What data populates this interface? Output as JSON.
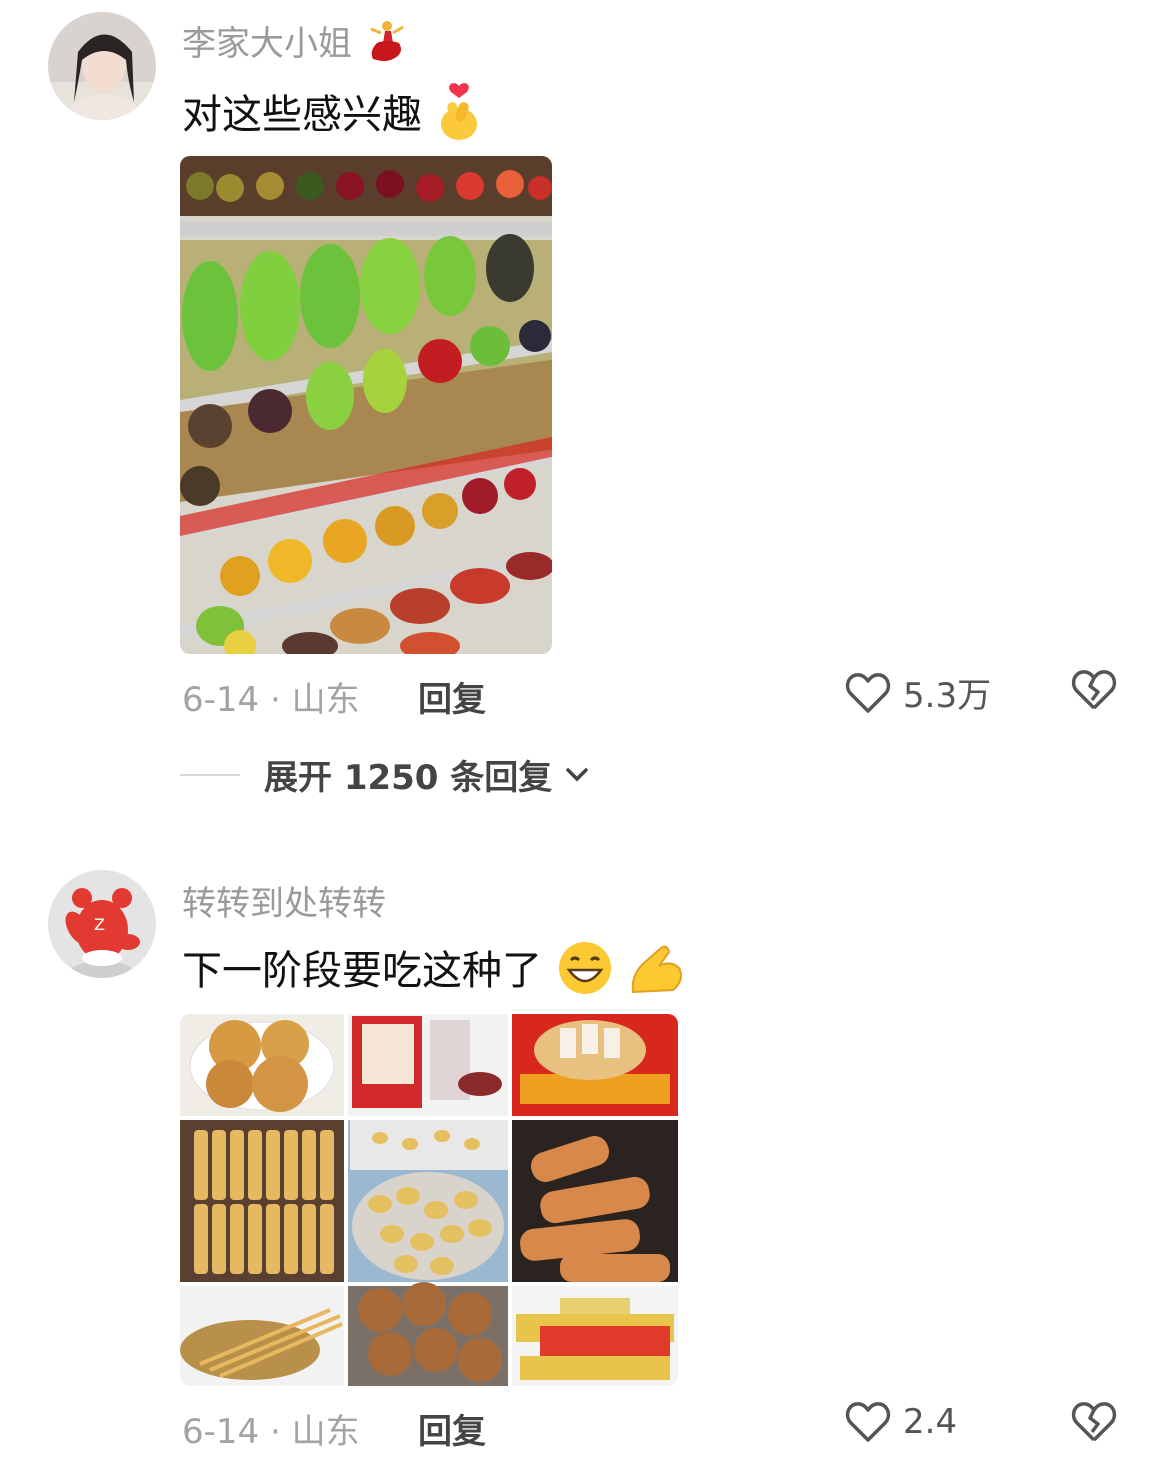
{
  "comments": [
    {
      "username": "李家大小姐",
      "username_badge_icon": "flamenco-dancer-emoji",
      "text": "对这些感兴趣",
      "text_emoji_icon": "finger-heart-emoji",
      "image_subject": "fruit-shelf-photo",
      "date_location": "6-14 · 山东",
      "reply_label": "回复",
      "like_count": "5.3万",
      "expand_label": "展开 1250 条回复"
    },
    {
      "username": "转转到处转转",
      "text": "下一阶段要吃这种了",
      "text_emoji_icons": [
        "grinning-face-emoji",
        "pinched-fingers-emoji"
      ],
      "image_subject": "snack-collage-photo",
      "date_location": "6-14 · 山东",
      "reply_label": "回复",
      "like_count": "2.4"
    }
  ],
  "colors": {
    "meta": "#a3a3a3",
    "text": "#111111",
    "username": "#9a9a9a",
    "heart": "#555555"
  }
}
